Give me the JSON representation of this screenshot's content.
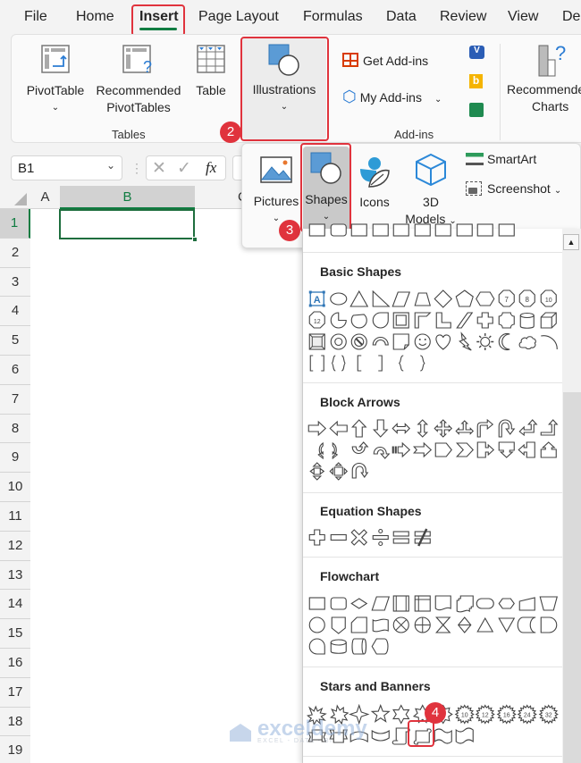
{
  "tabs": [
    {
      "label": "File"
    },
    {
      "label": "Home"
    },
    {
      "label": "Insert",
      "active": true
    },
    {
      "label": "Page Layout"
    },
    {
      "label": "Formulas"
    },
    {
      "label": "Data"
    },
    {
      "label": "Review"
    },
    {
      "label": "View"
    },
    {
      "label": "De"
    }
  ],
  "ribbon": {
    "tables_group": {
      "label": "Tables",
      "pivottable": "PivotTable",
      "recommended_line1": "Recommended",
      "recommended_line2": "PivotTables",
      "table": "Table"
    },
    "illustrations": {
      "label": "Illustrations"
    },
    "addins_group": {
      "label": "Add-ins",
      "get_addins": "Get Add-ins",
      "my_addins": "My Add-ins"
    },
    "charts": {
      "line1": "Recommende",
      "line2": "Charts"
    }
  },
  "illustrations_popup": {
    "pictures": "Pictures",
    "shapes": "Shapes",
    "icons": "Icons",
    "models_line1": "3D",
    "models_line2": "Models",
    "smartart": "SmartArt",
    "screenshot": "Screenshot"
  },
  "formula_bar": {
    "name_box": "B1",
    "fx": "fx",
    "formula": ""
  },
  "sheet": {
    "columns": [
      "A",
      "B",
      "C"
    ],
    "rows": [
      "1",
      "2",
      "3",
      "4",
      "5",
      "6",
      "7",
      "8",
      "9",
      "10",
      "11",
      "12",
      "13",
      "14",
      "15",
      "16",
      "17",
      "18",
      "19"
    ],
    "selected_cell": "B1"
  },
  "shapes_gallery": {
    "sections": [
      {
        "title": "Basic Shapes"
      },
      {
        "title": "Block Arrows"
      },
      {
        "title": "Equation Shapes"
      },
      {
        "title": "Flowchart"
      },
      {
        "title": "Stars and Banners"
      }
    ],
    "basic_labels": {
      "oct7": "7",
      "oct8": "8",
      "dec10": "10",
      "dodec12": "12"
    },
    "star_labels": [
      "10",
      "12",
      "16",
      "24",
      "32"
    ],
    "selected_shape": "Scroll: Vertical"
  },
  "callouts": [
    "1",
    "2",
    "3",
    "4"
  ],
  "watermark": {
    "name": "exceldemy",
    "tagline": "EXCEL - DATA - BI"
  },
  "colors": {
    "accent_green": "#107c41",
    "callout_red": "#e0333d",
    "shape_blue": "#5b9bd5"
  }
}
